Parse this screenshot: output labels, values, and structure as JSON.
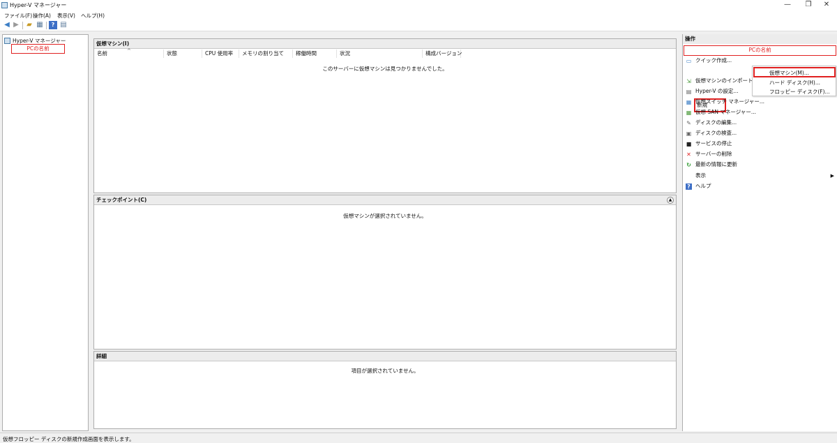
{
  "window": {
    "title": "Hyper-V マネージャー",
    "minimize_glyph": "—",
    "restore_glyph": "❐",
    "close_glyph": "✕"
  },
  "menu": [
    "ファイル(F)",
    "操作(A)",
    "表示(V)",
    "ヘルプ(H)"
  ],
  "toolbar": {
    "icons": [
      "back-arrow-icon",
      "forward-arrow-icon",
      "folder-up-icon",
      "console-tree-icon",
      "help-icon",
      "properties-icon"
    ]
  },
  "tree": {
    "root": "Hyper-V マネージャー",
    "server": "PCの名前"
  },
  "vm_panel": {
    "title": "仮想マシン(I)",
    "columns": [
      "名前",
      "状態",
      "CPU 使用率",
      "メモリの割り当て",
      "稼働時間",
      "状況",
      "構成バージョン"
    ],
    "sort_glyph": "^",
    "empty_message": "このサーバーに仮想マシンは見つかりませんでした。"
  },
  "checkpoint_panel": {
    "title": "チェックポイント(C)",
    "collapse_glyph": "▲",
    "empty_message": "仮想マシンが選択されていません。"
  },
  "details_panel": {
    "title": "詳細",
    "empty_message": "項目が選択されていません。"
  },
  "actions": {
    "title": "操作",
    "section": "PCの名前",
    "items": [
      {
        "label": "クイック作成...",
        "icon": "quick-create-icon",
        "glyph": "▭",
        "color": "#3d7fc6"
      },
      {
        "label": "新規",
        "icon": "",
        "glyph": "",
        "color": "#111111"
      },
      {
        "label": "仮想マシンのインポート...",
        "icon": "import-icon",
        "glyph": "⇲",
        "color": "#4a9a3a"
      },
      {
        "label": "Hyper-V の設定...",
        "icon": "settings-icon",
        "glyph": "▤",
        "color": "#666666"
      },
      {
        "label": "仮想スイッチ マネージャー...",
        "icon": "switch-icon",
        "glyph": "▦",
        "color": "#3d7fc6"
      },
      {
        "label": "仮想 SAN マネージャー...",
        "icon": "san-icon",
        "glyph": "▦",
        "color": "#4a9a3a"
      },
      {
        "label": "ディスクの編集...",
        "icon": "edit-disk-icon",
        "glyph": "✎",
        "color": "#666666"
      },
      {
        "label": "ディスクの検査...",
        "icon": "inspect-disk-icon",
        "glyph": "▣",
        "color": "#666666"
      },
      {
        "label": "サービスの停止",
        "icon": "stop-service-icon",
        "glyph": "■",
        "color": "#222222"
      },
      {
        "label": "サーバーの削除",
        "icon": "remove-server-icon",
        "glyph": "✕",
        "color": "#e02020"
      },
      {
        "label": "最新の情報に更新",
        "icon": "refresh-icon",
        "glyph": "↻",
        "color": "#2e9a2e"
      },
      {
        "label": "表示",
        "icon": "",
        "glyph": "",
        "color": "#111111"
      },
      {
        "label": "ヘルプ",
        "icon": "help-icon",
        "glyph": "?",
        "color": "#3d6fc6"
      }
    ],
    "view_arrow": "▶"
  },
  "context_menu": {
    "items": [
      "仮想マシン(M)...",
      "ハード ディスク(H)...",
      "フロッピー ディスク(F)..."
    ]
  },
  "status": "仮想フロッピー ディスクの新規作成画面を表示します。",
  "colors": {
    "highlight": "#e02020"
  }
}
